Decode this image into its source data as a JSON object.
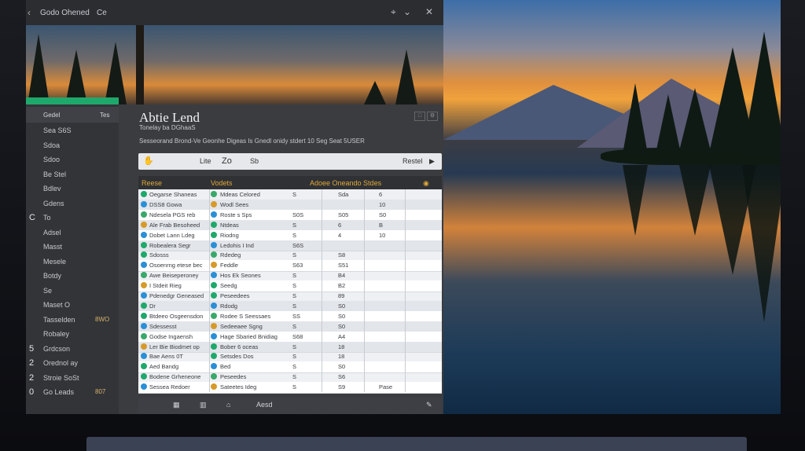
{
  "titlebar": {
    "app_title": "Godo Ohened",
    "subtitle": "Ce"
  },
  "sidebar": {
    "header_left": "Gedel",
    "header_right": "Tes",
    "items": [
      {
        "num": "",
        "label": "Sea S6S",
        "val": ""
      },
      {
        "num": "",
        "label": "Sdoa",
        "val": ""
      },
      {
        "num": "",
        "label": "Sdoo",
        "val": ""
      },
      {
        "num": "",
        "label": "Be Stel",
        "val": ""
      },
      {
        "num": "",
        "label": "Bdlev",
        "val": ""
      },
      {
        "num": "",
        "label": "Gdens",
        "val": ""
      },
      {
        "num": "C",
        "label": "To",
        "val": ""
      },
      {
        "num": "",
        "label": "Adsel",
        "val": ""
      },
      {
        "num": "",
        "label": "Masst",
        "val": ""
      },
      {
        "num": "",
        "label": "Mesele",
        "val": ""
      },
      {
        "num": "",
        "label": "Botdy",
        "val": ""
      },
      {
        "num": "",
        "label": "Se",
        "val": ""
      },
      {
        "num": "",
        "label": "Maset O",
        "val": ""
      },
      {
        "num": "",
        "label": "Tasselden",
        "val": "8WO"
      },
      {
        "num": "",
        "label": "Robaley",
        "val": ""
      },
      {
        "num": "5",
        "label": "Grdcson",
        "val": ""
      },
      {
        "num": "2",
        "label": "Orednol ay",
        "val": ""
      },
      {
        "num": "2",
        "label": "Stroie SoSt",
        "val": ""
      },
      {
        "num": "0",
        "label": "Go Leads",
        "val": "807"
      }
    ]
  },
  "main": {
    "title": "Abtie Lend",
    "subtitle": "Tonelay ba DGhaaS",
    "description": "Sesseorand Brond-Ve Geonhe Digeas Is Gnedl onidy stdert 10 Seg Seat 5USER",
    "toolbar": {
      "left": "Lite",
      "mid": "Zo",
      "mid2": "Sb",
      "right": "Restel"
    }
  },
  "table": {
    "headers": [
      "Reese",
      "Vodets",
      "Adoee Oneando Stdes"
    ],
    "rows": [
      {
        "c1": "Oegarse Shaneas",
        "c2": "Mdeas Celored",
        "c3": "S",
        "c4": "Sda",
        "c5": "6",
        "c6": ""
      },
      {
        "c1": "DSS8 Gowa",
        "c2": "Wodl Sees",
        "c3": "",
        "c4": "",
        "c5": "10",
        "c6": ""
      },
      {
        "c1": "Ndesela PGS reb",
        "c2": "Roste s Sps",
        "c3": "S0S",
        "c4": "S05",
        "c5": "S0",
        "c6": ""
      },
      {
        "c1": "Ale Frab Besoheed",
        "c2": "Ntdeas",
        "c3": "S",
        "c4": "6",
        "c5": "B",
        "c6": ""
      },
      {
        "c1": "Dobet Lann Ldeg",
        "c2": "Riodng",
        "c3": "S",
        "c4": "4",
        "c5": "10",
        "c6": ""
      },
      {
        "c1": "Robealera Segr",
        "c2": "Ledohis I Ind",
        "c3": "S6S",
        "c4": "",
        "c5": "",
        "c6": ""
      },
      {
        "c1": "Sdosss",
        "c2": "Rdedeg",
        "c3": "S",
        "c4": "S8",
        "c5": "",
        "c6": ""
      },
      {
        "c1": "Osoenrng etese bec",
        "c2": "Feddle",
        "c3": "S63",
        "c4": "S51",
        "c5": "",
        "c6": ""
      },
      {
        "c1": "Awe Beiseperoney",
        "c2": "Hos Ek Seones",
        "c3": "S",
        "c4": "B4",
        "c5": "",
        "c6": ""
      },
      {
        "c1": "I Stdeit Rieg",
        "c2": "Seedg",
        "c3": "S",
        "c4": "B2",
        "c5": "",
        "c6": ""
      },
      {
        "c1": "Pdenedgr Geneased",
        "c2": "Peseedees",
        "c3": "S",
        "c4": "89",
        "c5": "",
        "c6": ""
      },
      {
        "c1": "Dr",
        "c2": "Rdodg",
        "c3": "S",
        "c4": "S0",
        "c5": "",
        "c6": ""
      },
      {
        "c1": "Btdeeo Osgeensdon",
        "c2": "Rodee S Seessaes",
        "c3": "SS",
        "c4": "S0",
        "c5": "",
        "c6": ""
      },
      {
        "c1": "Sdessesst",
        "c2": "Sedeeaee Sgng",
        "c3": "S",
        "c4": "S0",
        "c5": "",
        "c6": ""
      },
      {
        "c1": "Godse Ingaensh",
        "c2": "Hage Sbaried Bnidiag",
        "c3": "S68",
        "c4": "A4",
        "c5": "",
        "c6": ""
      },
      {
        "c1": "Ler Bie Biodmet op",
        "c2": "Bober 6 oceas",
        "c3": "S",
        "c4": "18",
        "c5": "",
        "c6": ""
      },
      {
        "c1": "Bae Aens 0T",
        "c2": "Setsdes Dos",
        "c3": "S",
        "c4": "18",
        "c5": "",
        "c6": ""
      },
      {
        "c1": "Aed Bandg",
        "c2": "Bed",
        "c3": "S",
        "c4": "S0",
        "c5": "",
        "c6": ""
      },
      {
        "c1": "Bodene Grheneone",
        "c2": "Peseedes",
        "c3": "S",
        "c4": "S6",
        "c5": "",
        "c6": ""
      },
      {
        "c1": "Sessea Redoer",
        "c2": "Sateetes Ideg",
        "c3": "S",
        "c4": "S9",
        "c5": "Pase",
        "c6": ""
      }
    ]
  },
  "bottombar": {
    "label": "Aesd"
  },
  "colors": {
    "accent": "#1fa86b",
    "header_text": "#e0a83a"
  }
}
